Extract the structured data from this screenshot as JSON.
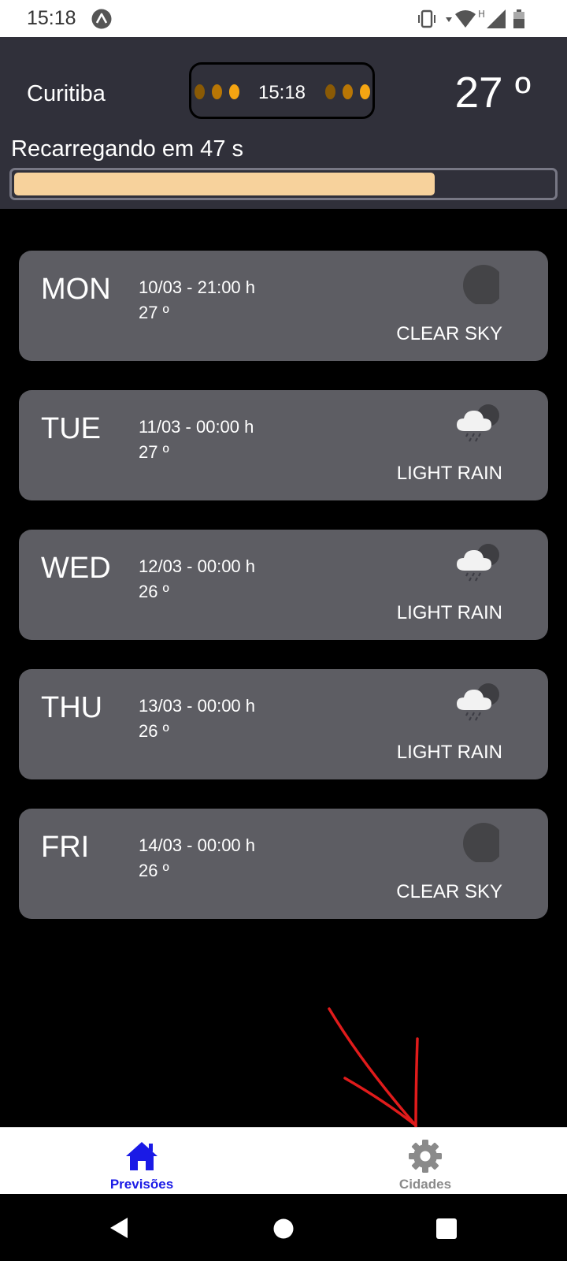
{
  "status_bar": {
    "time": "15:18",
    "icons": [
      "app-a-icon",
      "vibrate-icon",
      "data-arrow-icon",
      "wifi-icon",
      "signal-h-icon",
      "cell-signal-icon",
      "battery-icon"
    ]
  },
  "header": {
    "city": "Curitiba",
    "clock_time": "15:18",
    "temperature": "27 º",
    "reload_text": "Recarregando em 47 s",
    "reload_progress_percent": 78,
    "progress_color": "#f7d29c",
    "background_color": "#30303a"
  },
  "forecast": [
    {
      "day": "MON",
      "datetime": "10/03 - 21:00 h",
      "temp": "27 º",
      "description": "CLEAR SKY",
      "icon": "clear-sky-night-icon"
    },
    {
      "day": "TUE",
      "datetime": "11/03 - 00:00 h",
      "temp": "27 º",
      "description": "LIGHT RAIN",
      "icon": "light-rain-icon"
    },
    {
      "day": "WED",
      "datetime": "12/03 - 00:00 h",
      "temp": "26 º",
      "description": "LIGHT RAIN",
      "icon": "light-rain-icon"
    },
    {
      "day": "THU",
      "datetime": "13/03 - 00:00 h",
      "temp": "26 º",
      "description": "LIGHT RAIN",
      "icon": "light-rain-icon"
    },
    {
      "day": "FRI",
      "datetime": "14/03 - 00:00 h",
      "temp": "26 º",
      "description": "CLEAR SKY",
      "icon": "clear-sky-night-icon"
    }
  ],
  "bottom_nav": {
    "items": [
      {
        "label": "Previsões",
        "icon": "home-icon",
        "active": true
      },
      {
        "label": "Cidades",
        "icon": "gear-icon",
        "active": false
      }
    ],
    "active_color": "#1a1ae6",
    "inactive_color": "#8a8a8a"
  },
  "system_nav": {
    "icons": [
      "back-icon",
      "home-circle-icon",
      "recents-icon"
    ]
  },
  "annotation": {
    "icon": "red-arrow-annotation-icon",
    "color": "#e01b1b"
  }
}
